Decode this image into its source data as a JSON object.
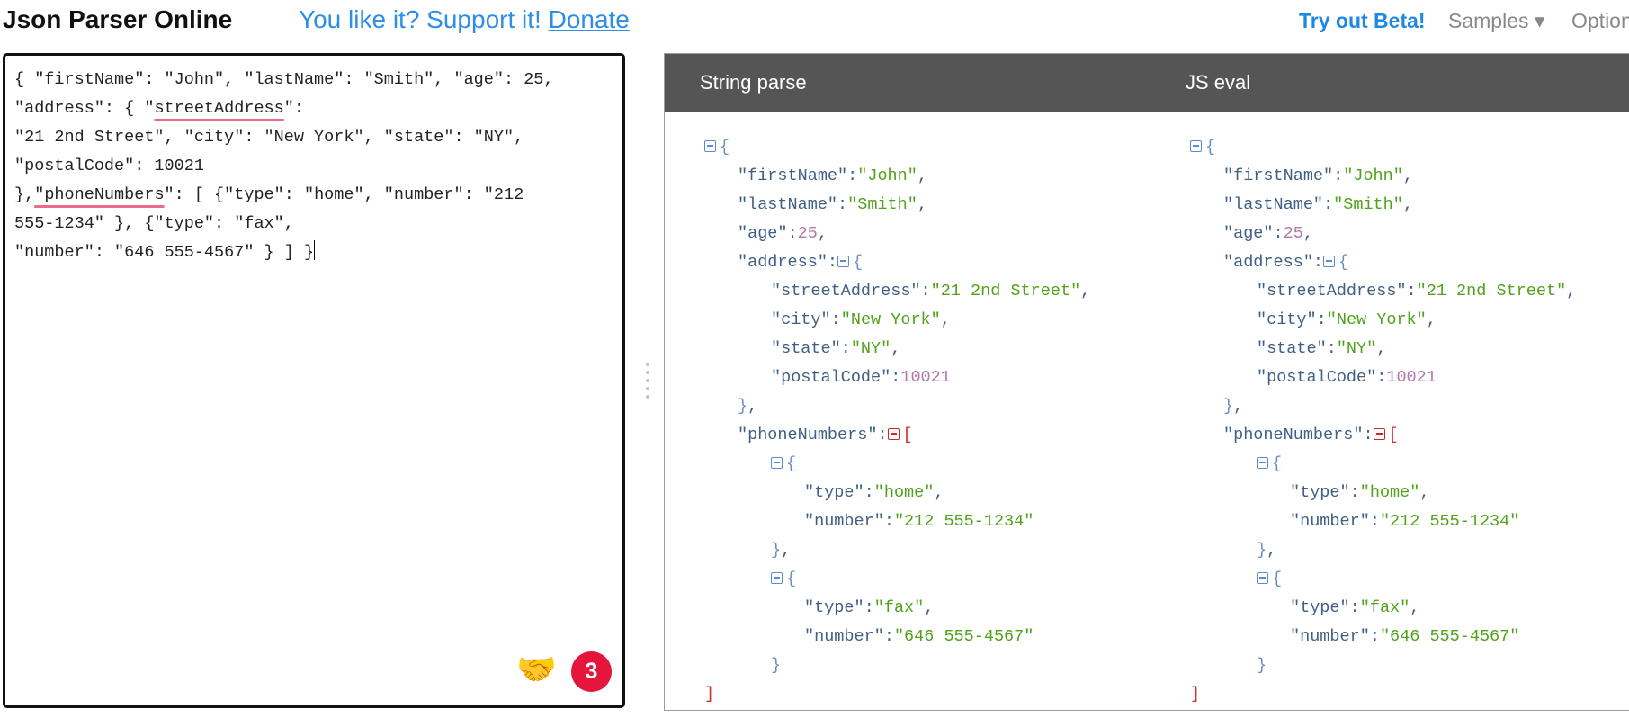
{
  "header": {
    "title": "Json Parser Online",
    "support_text": "You like it? Support it!",
    "donate_label": "Donate",
    "beta_label": "Try out Beta!",
    "samples_label": "Samples ▾",
    "options_label": "Options"
  },
  "editor": {
    "lines": [
      "{ \"firstName\": \"John\", \"lastName\": \"Smith\", \"age\": 25,",
      "\"address\": { \"",
      "streetAddress",
      "\":",
      "\"21 2nd Street\", \"city\": \"New York\", \"state\": \"NY\",",
      "\"postalCode\": 10021",
      "},",
      "\"phoneNumbers",
      "\": [ {\"type\": \"home\", \"number\": \"212",
      "555-1234\" }, {\"type\": \"fax\",",
      "\"number\": \"646 555-4567\" } ] }"
    ],
    "badge_count": "3",
    "extension_icon": "handshake-icon"
  },
  "results": {
    "string_parse_title": "String parse",
    "js_eval_title": "JS eval",
    "tree": [
      {
        "indent": 0,
        "toggle": "blue",
        "open": "{"
      },
      {
        "indent": 1,
        "key": "\"firstName\"",
        "value": "\"John\"",
        "vtype": "str",
        "comma": ","
      },
      {
        "indent": 1,
        "key": "\"lastName\"",
        "value": "\"Smith\"",
        "vtype": "str",
        "comma": ","
      },
      {
        "indent": 1,
        "key": "\"age\"",
        "value": "25",
        "vtype": "num",
        "comma": ","
      },
      {
        "indent": 1,
        "key": "\"address\"",
        "toggle": "blue",
        "open": "{"
      },
      {
        "indent": 2,
        "key": "\"streetAddress\"",
        "value": "\"21 2nd Street\"",
        "vtype": "str",
        "comma": ","
      },
      {
        "indent": 2,
        "key": "\"city\"",
        "value": "\"New York\"",
        "vtype": "str",
        "comma": ","
      },
      {
        "indent": 2,
        "key": "\"state\"",
        "value": "\"NY\"",
        "vtype": "str",
        "comma": ","
      },
      {
        "indent": 2,
        "key": "\"postalCode\"",
        "value": "10021",
        "vtype": "num",
        "comma": ""
      },
      {
        "indent": 1,
        "close": "}",
        "comma": ","
      },
      {
        "indent": 1,
        "key": "\"phoneNumbers\"",
        "toggle": "red",
        "open": "["
      },
      {
        "indent": 2,
        "toggle": "blue",
        "open": "{"
      },
      {
        "indent": 3,
        "key": "\"type\"",
        "value": "\"home\"",
        "vtype": "str",
        "comma": ","
      },
      {
        "indent": 3,
        "key": "\"number\"",
        "value": "\"212 555-1234\"",
        "vtype": "str",
        "comma": ""
      },
      {
        "indent": 2,
        "close": "}",
        "comma": ","
      },
      {
        "indent": 2,
        "toggle": "blue",
        "open": "{"
      },
      {
        "indent": 3,
        "key": "\"type\"",
        "value": "\"fax\"",
        "vtype": "str",
        "comma": ","
      },
      {
        "indent": 3,
        "key": "\"number\"",
        "value": "\"646 555-4567\"",
        "vtype": "str",
        "comma": ""
      },
      {
        "indent": 2,
        "close": "}",
        "comma": ""
      },
      {
        "indent": 0,
        "close": "]",
        "closeType": "arr",
        "comma": ""
      }
    ]
  },
  "colors": {
    "accent": "#1e88e5",
    "header_bg": "#555555",
    "key": "#3f5f86",
    "string": "#4fa21a",
    "number": "#b578a6",
    "badge": "#e5163c"
  }
}
